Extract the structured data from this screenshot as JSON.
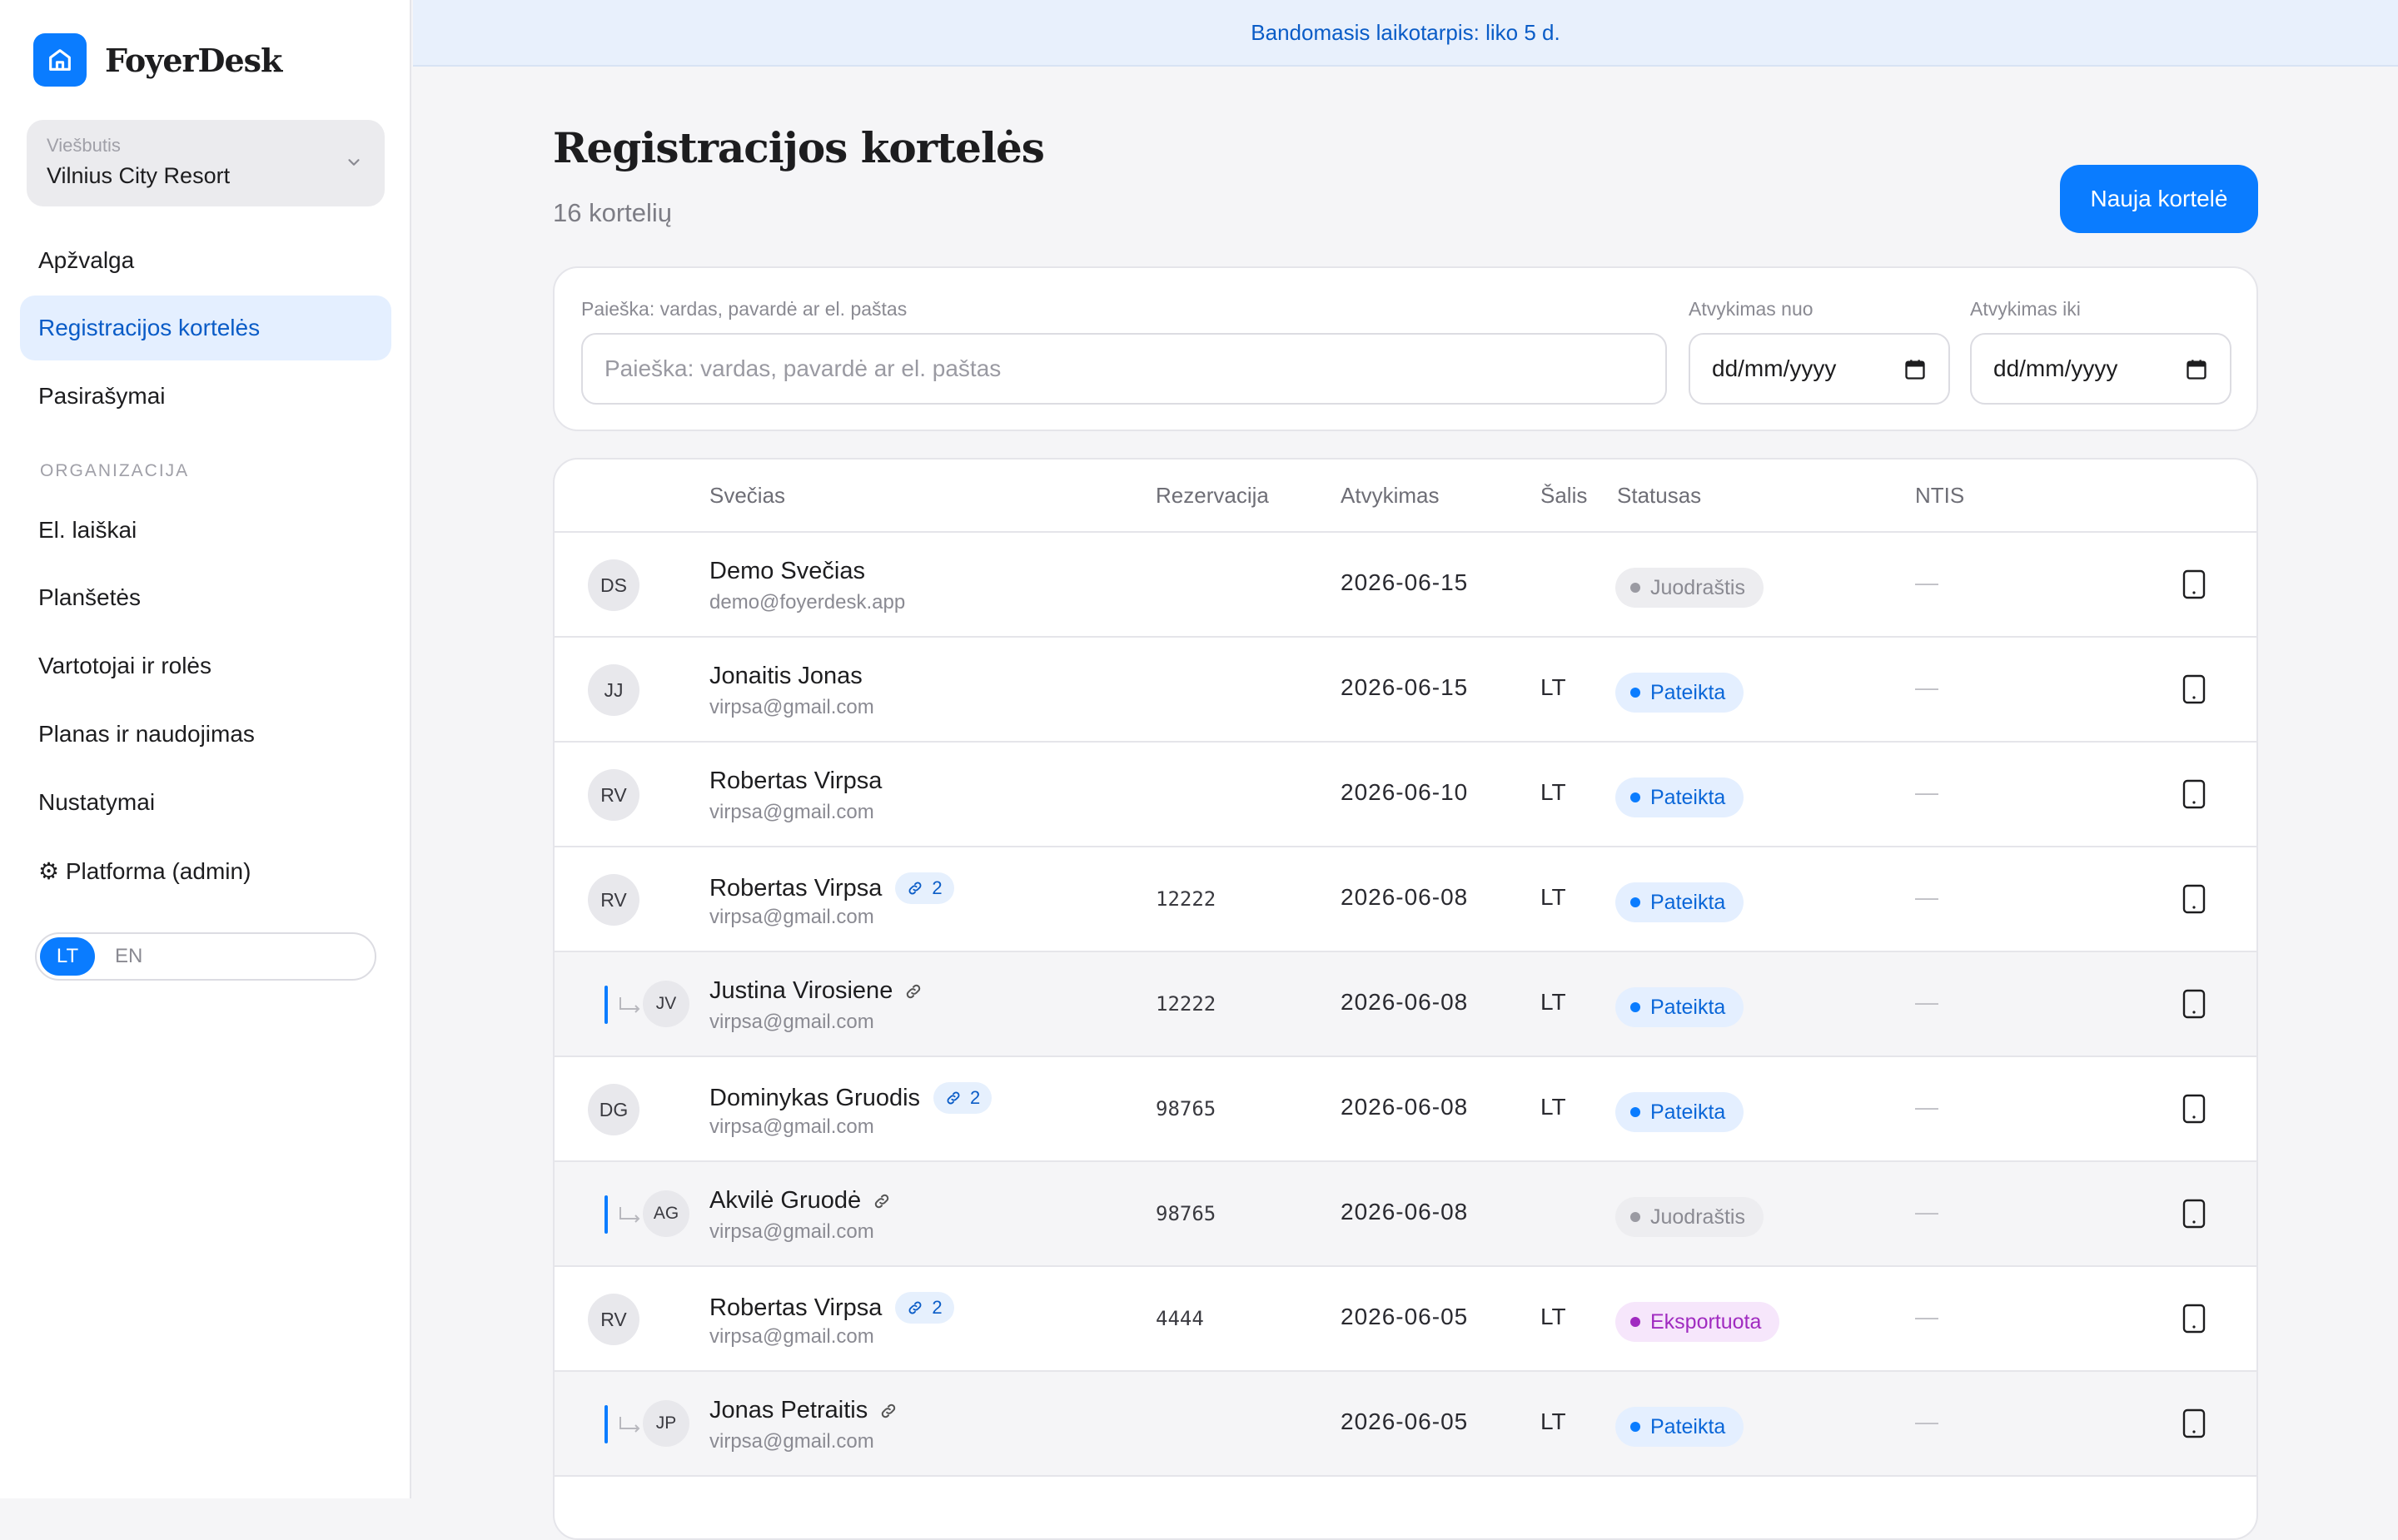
{
  "trial_banner": "Bandomasis laikotarpis: liko 5 d.",
  "brand": {
    "name": "FoyerDesk",
    "logo_icon": "home-icon",
    "accent": "#0a7cff"
  },
  "hotel": {
    "label": "Viešbutis",
    "value": "Vilnius City Resort"
  },
  "nav": [
    {
      "label": "Apžvalga"
    },
    {
      "label": "Registracijos kortelės",
      "active": true
    },
    {
      "label": "Pasirašymai"
    }
  ],
  "nav_section": "ORGANIZACIJA",
  "nav_org": [
    {
      "label": "El. laiškai"
    },
    {
      "label": "Planšetės"
    },
    {
      "label": "Vartotojai ir rolės"
    },
    {
      "label": "Planas ir naudojimas"
    },
    {
      "label": "Nustatymai"
    },
    {
      "label": "⚙ Platforma (admin)"
    }
  ],
  "lang": {
    "lt": "LT",
    "en": "EN",
    "selected": "LT"
  },
  "page": {
    "title": "Registracijos kortelės",
    "subtitle": "16 kortelių",
    "new_button": "Nauja kortelė"
  },
  "filters": {
    "search_label": "Paieška: vardas, pavardė ar el. paštas",
    "search_placeholder": "Paieška: vardas, pavardė ar el. paštas",
    "from_label": "Atvykimas nuo",
    "from_value": "dd/mm/yyyy",
    "to_label": "Atvykimas iki",
    "to_value": "dd/mm/yyyy"
  },
  "table": {
    "headers": {
      "guest": "Svečias",
      "reservation": "Rezervacija",
      "arrival": "Atvykimas",
      "country": "Šalis",
      "status": "Statusas",
      "ntis": "NTIS"
    },
    "rows": [
      {
        "initials": "DS",
        "name": "Demo Svečias",
        "email": "demo@foyerdesk.app",
        "reservation": "",
        "arrival": "2026-06-15",
        "country": "",
        "status": "Juodraštis",
        "status_type": "draft",
        "ntis": "—",
        "linked": false,
        "link_count": ""
      },
      {
        "initials": "JJ",
        "name": "Jonaitis Jonas",
        "email": "virpsa@gmail.com",
        "reservation": "",
        "arrival": "2026-06-15",
        "country": "LT",
        "status": "Pateikta",
        "status_type": "submitted",
        "ntis": "—",
        "linked": false,
        "link_count": ""
      },
      {
        "initials": "RV",
        "name": "Robertas Virpsa",
        "email": "virpsa@gmail.com",
        "reservation": "",
        "arrival": "2026-06-10",
        "country": "LT",
        "status": "Pateikta",
        "status_type": "submitted",
        "ntis": "—",
        "linked": false,
        "link_count": ""
      },
      {
        "initials": "RV",
        "name": "Robertas Virpsa",
        "email": "virpsa@gmail.com",
        "reservation": "12222",
        "arrival": "2026-06-08",
        "country": "LT",
        "status": "Pateikta",
        "status_type": "submitted",
        "ntis": "—",
        "linked": false,
        "link_count": "2"
      },
      {
        "initials": "JV",
        "name": "Justina Virosiene",
        "email": "virpsa@gmail.com",
        "reservation": "12222",
        "arrival": "2026-06-08",
        "country": "LT",
        "status": "Pateikta",
        "status_type": "submitted",
        "ntis": "—",
        "linked": true,
        "link_count": ""
      },
      {
        "initials": "DG",
        "name": "Dominykas Gruodis",
        "email": "virpsa@gmail.com",
        "reservation": "98765",
        "arrival": "2026-06-08",
        "country": "LT",
        "status": "Pateikta",
        "status_type": "submitted",
        "ntis": "—",
        "linked": false,
        "link_count": "2"
      },
      {
        "initials": "AG",
        "name": "Akvilė Gruodė",
        "email": "virpsa@gmail.com",
        "reservation": "98765",
        "arrival": "2026-06-08",
        "country": "",
        "status": "Juodraštis",
        "status_type": "draft",
        "ntis": "—",
        "linked": true,
        "link_count": ""
      },
      {
        "initials": "RV",
        "name": "Robertas Virpsa",
        "email": "virpsa@gmail.com",
        "reservation": "4444",
        "arrival": "2026-06-05",
        "country": "LT",
        "status": "Eksportuota",
        "status_type": "exported",
        "ntis": "—",
        "linked": false,
        "link_count": "2"
      },
      {
        "initials": "JP",
        "name": "Jonas Petraitis",
        "email": "virpsa@gmail.com",
        "reservation": "",
        "arrival": "2026-06-05",
        "country": "LT",
        "status": "Pateikta",
        "status_type": "submitted",
        "ntis": "—",
        "linked": true,
        "link_count": ""
      }
    ]
  }
}
